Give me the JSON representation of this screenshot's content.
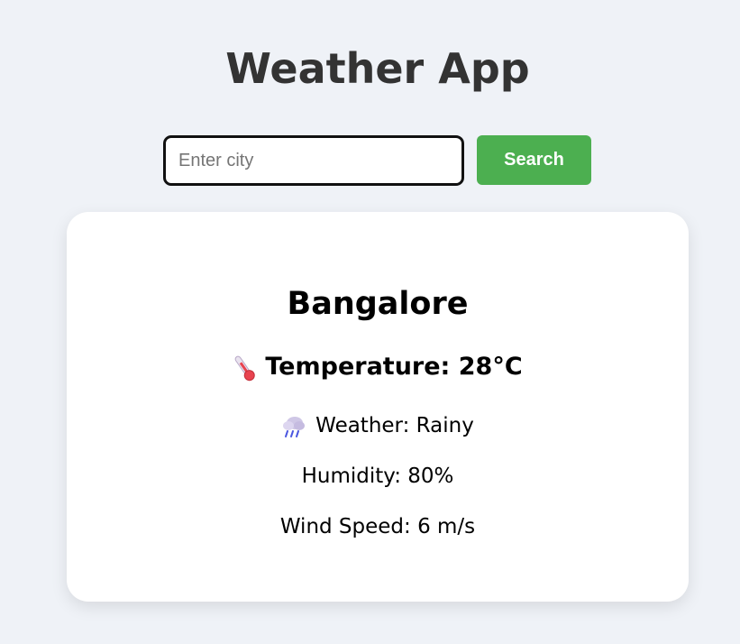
{
  "app": {
    "title": "Weather App"
  },
  "search": {
    "placeholder": "Enter city",
    "value": "",
    "button_label": "Search"
  },
  "weather": {
    "city": "Bangalore",
    "temperature_text": "Temperature: 28°C",
    "temperature_icon": "thermometer-icon",
    "condition_text": "Weather: Rainy",
    "condition_icon": "rain-cloud-icon",
    "humidity_text": "Humidity: 80%",
    "wind_text": "Wind Speed: 6 m/s"
  },
  "colors": {
    "background": "#eff2f7",
    "accent": "#4caf50",
    "card": "#ffffff",
    "title": "#333333"
  }
}
